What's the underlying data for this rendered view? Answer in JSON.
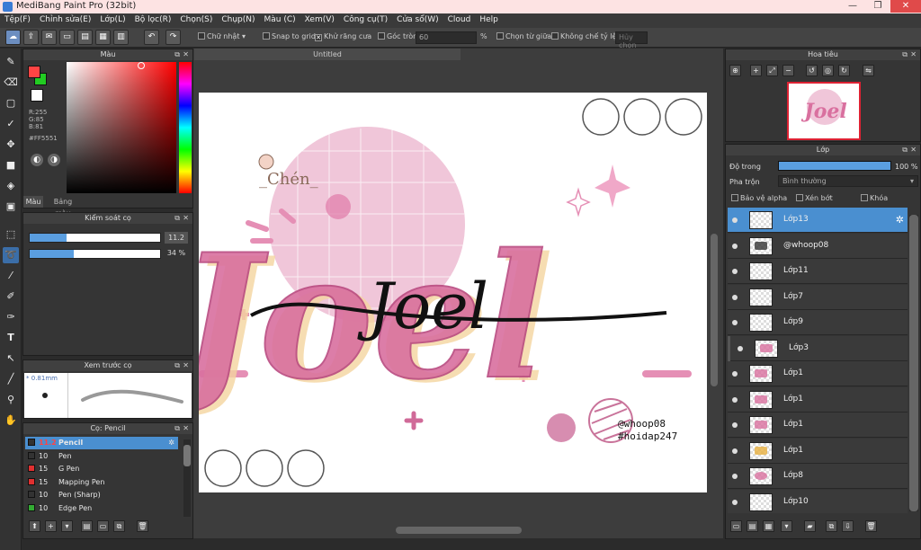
{
  "window": {
    "title": "MediBang Paint Pro (32bit)",
    "min": "—",
    "max": "❐",
    "close": "✕"
  },
  "menu": [
    "Tệp(F)",
    "Chỉnh sửa(E)",
    "Lớp(L)",
    "Bộ lọc(R)",
    "Chọn(S)",
    "Chụp(N)",
    "Màu (C)",
    "Xem(V)",
    "Công cụ(T)",
    "Cửa sổ(W)",
    "Cloud",
    "Help"
  ],
  "toolbar": {
    "shape_label": "Chữ nhật",
    "snap": "Snap to grid",
    "antialias": "Khử răng cưa",
    "round": "Góc tròn",
    "round_value": "60",
    "percent": "%",
    "center": "Chọn từ giữa",
    "ratio": "Không chế tỷ lệ",
    "desel": "Hủy chọn"
  },
  "color_panel": {
    "title": "Màu",
    "r": "R:255",
    "g": "G:85",
    "b": "B:81",
    "hex": "#FF5551",
    "tab_color": "Màu",
    "tab_palette": "Bảng màu",
    "primary": "#ff4444",
    "secondary": "#22cc22"
  },
  "brush_control": {
    "title": "Kiểm soát cọ",
    "size": "11.2",
    "size_fill": 0.28,
    "opacity": "34 %",
    "opacity_fill": 0.34
  },
  "brush_preview": {
    "title": "Xem trước cọ",
    "size": "0.81mm"
  },
  "brush_list": {
    "title": "Cọ: Pencil",
    "items": [
      {
        "size": "11.2",
        "name": "Pencil",
        "color": "#333333"
      },
      {
        "size": "10",
        "name": "Pen",
        "color": "#333333"
      },
      {
        "size": "15",
        "name": "G Pen",
        "color": "#e03030"
      },
      {
        "size": "15",
        "name": "Mapping Pen",
        "color": "#e03030"
      },
      {
        "size": "10",
        "name": "Pen (Sharp)",
        "color": "#333333"
      },
      {
        "size": "10",
        "name": "Edge Pen",
        "color": "#33aa33"
      }
    ]
  },
  "document": {
    "tab": "Untitled"
  },
  "artwork": {
    "chen": "_Chén_",
    "script": "Joel",
    "main": "Joel",
    "credit1": "@whoop08",
    "credit2": "#hoidap247"
  },
  "navigator": {
    "title": "Hoa tiêu",
    "thumb_text": "Joel"
  },
  "layers_panel": {
    "title": "Lớp",
    "opacity_label": "Độ trong",
    "opacity_value": "100 %",
    "opacity_fill": 1.0,
    "blend_label": "Pha trộn",
    "blend_value": "Bình thường",
    "protect_alpha": "Bảo vệ alpha",
    "clip": "Xén bớt",
    "lock": "Khóa",
    "layers": [
      "Lớp13",
      "@whoop08",
      "Lớp11",
      "Lớp7",
      "Lớp9",
      "Lớp3",
      "Lớp1",
      "Lớp1",
      "Lớp1",
      "Lớp1",
      "Lớp8",
      "Lớp10"
    ]
  }
}
